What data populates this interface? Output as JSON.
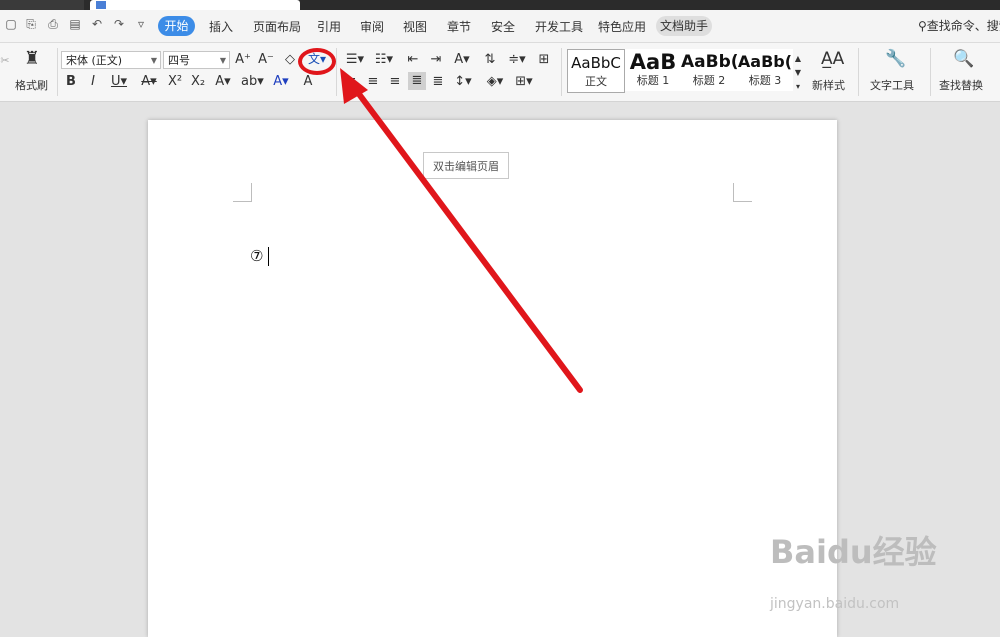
{
  "menu": {
    "items": [
      "开始",
      "插入",
      "页面布局",
      "引用",
      "审阅",
      "视图",
      "章节",
      "安全",
      "开发工具",
      "特色应用",
      "文档助手"
    ],
    "search_label": "查找命令、搜索"
  },
  "ribbon": {
    "format_painter_label": "格式刷",
    "font_name": "宋体 (正文)",
    "font_size": "四号",
    "styles": [
      {
        "sample": "AaBbC",
        "name": "正文"
      },
      {
        "sample": "AaB",
        "name": "标题 1"
      },
      {
        "sample": "AaBb(",
        "name": "标题 2"
      },
      {
        "sample": "AaBb(",
        "name": "标题 3"
      }
    ],
    "new_style_label": "新样式",
    "text_tools_label": "文字工具",
    "find_replace_label": "查找替换"
  },
  "document": {
    "header_button_label": "双击编辑页眉",
    "content_text": "⑦"
  },
  "annotation": {
    "highlight_color": "#e0161b"
  },
  "watermark": {
    "brand": "Baidu经验",
    "url": "jingyan.baidu.com"
  }
}
